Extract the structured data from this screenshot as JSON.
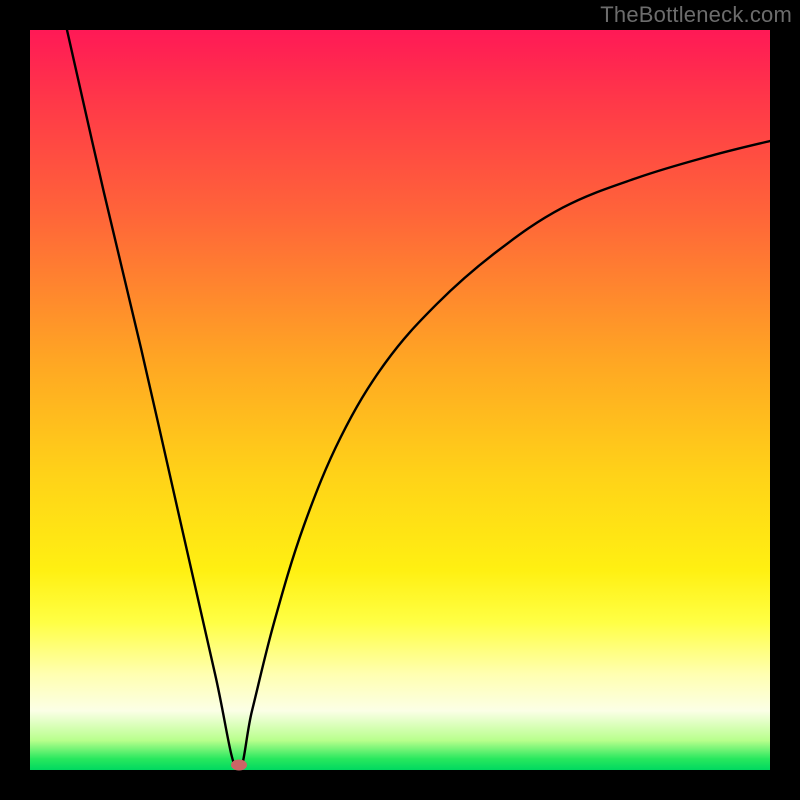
{
  "watermark": "TheBottleneck.com",
  "chart_data": {
    "type": "line",
    "title": "",
    "xlabel": "",
    "ylabel": "",
    "xlim": [
      0,
      100
    ],
    "ylim": [
      0,
      100
    ],
    "grid": false,
    "legend": false,
    "note": "V-shaped bottleneck curve over rainbow gradient; left branch is near-linear steep descent, right branch is a decelerating rise. Y-values estimated as percentage height; minimum near x≈28.",
    "series": [
      {
        "name": "left-branch",
        "x": [
          5,
          10,
          15,
          20,
          25,
          28
        ],
        "values": [
          100,
          78,
          57,
          35,
          13,
          0
        ]
      },
      {
        "name": "right-branch",
        "x": [
          28,
          30,
          33,
          37,
          42,
          48,
          55,
          63,
          72,
          82,
          92,
          100
        ],
        "values": [
          0,
          8,
          20,
          33,
          45,
          55,
          63,
          70,
          76,
          80,
          83,
          85
        ]
      }
    ],
    "marker": {
      "x": 28.2,
      "y": 0.7,
      "color": "#cc6666"
    },
    "gradient_stops": [
      {
        "pos": 0,
        "color": "#ff1956"
      },
      {
        "pos": 0.1,
        "color": "#ff3948"
      },
      {
        "pos": 0.25,
        "color": "#ff6539"
      },
      {
        "pos": 0.45,
        "color": "#ffa723"
      },
      {
        "pos": 0.6,
        "color": "#ffd218"
      },
      {
        "pos": 0.73,
        "color": "#fff012"
      },
      {
        "pos": 0.8,
        "color": "#ffff44"
      },
      {
        "pos": 0.87,
        "color": "#ffffb0"
      },
      {
        "pos": 0.92,
        "color": "#fbffe6"
      },
      {
        "pos": 0.96,
        "color": "#b8ff8c"
      },
      {
        "pos": 0.985,
        "color": "#28e85e"
      },
      {
        "pos": 1.0,
        "color": "#00d860"
      }
    ]
  }
}
